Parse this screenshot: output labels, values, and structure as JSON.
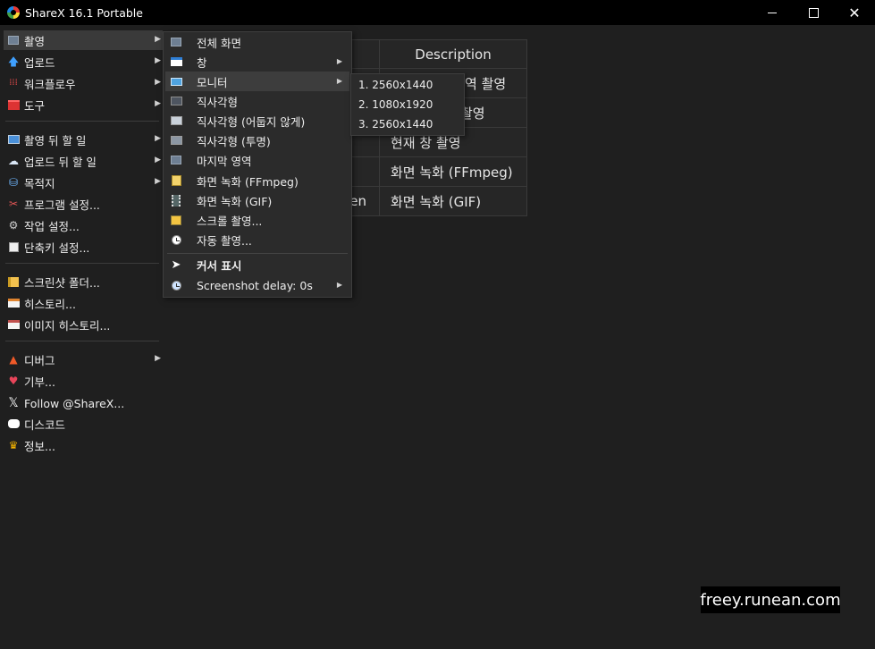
{
  "window": {
    "title": "ShareX 16.1 Portable"
  },
  "main_menu": {
    "items": [
      {
        "label": "촬영",
        "icon": "camera-icon",
        "has_submenu": true,
        "selected": true
      },
      {
        "label": "업로드",
        "icon": "upload-arrow-icon",
        "has_submenu": true
      },
      {
        "label": "워크플로우",
        "icon": "workflow-grid-icon",
        "has_submenu": true
      },
      {
        "label": "도구",
        "icon": "toolbox-icon",
        "has_submenu": true
      },
      {
        "label": "촬영 뒤 할 일",
        "icon": "after-capture-icon",
        "has_submenu": true
      },
      {
        "label": "업로드 뒤 할 일",
        "icon": "after-upload-cloud-icon",
        "has_submenu": true
      },
      {
        "label": "목적지",
        "icon": "destination-icon",
        "has_submenu": true
      },
      {
        "label": "프로그램 설정...",
        "icon": "settings-tools-icon"
      },
      {
        "label": "작업 설정...",
        "icon": "gear-icon"
      },
      {
        "label": "단축키 설정...",
        "icon": "keyboard-icon"
      },
      {
        "label": "스크린샷 폴더...",
        "icon": "folder-icon"
      },
      {
        "label": "히스토리...",
        "icon": "history-icon"
      },
      {
        "label": "이미지 히스토리...",
        "icon": "image-history-icon"
      },
      {
        "label": "디버그",
        "icon": "traffic-cone-icon",
        "has_submenu": true
      },
      {
        "label": "기부...",
        "icon": "heart-icon"
      },
      {
        "label": "Follow @ShareX...",
        "icon": "x-logo-icon"
      },
      {
        "label": "디스코드",
        "icon": "discord-icon"
      },
      {
        "label": "정보...",
        "icon": "crown-icon"
      }
    ]
  },
  "background_table": {
    "header": "Description",
    "rows": [
      "역 촬영",
      "촬영",
      "현재 창 촬영",
      "화면 녹화 (FFmpeg)",
      "화면 녹화 (GIF)"
    ],
    "left_fragment": "en"
  },
  "capture_submenu": {
    "items": [
      {
        "label": "전체 화면",
        "icon": "fullscreen-icon"
      },
      {
        "label": "창",
        "icon": "window-icon",
        "has_submenu": true
      },
      {
        "label": "모니터",
        "icon": "monitor-icon",
        "has_submenu": true,
        "selected": true
      },
      {
        "label": "직사각형",
        "icon": "rectangle-icon"
      },
      {
        "label": "직사각형 (어둡지 않게)",
        "icon": "rectangle-light-icon"
      },
      {
        "label": "직사각형 (투명)",
        "icon": "rectangle-transparent-icon"
      },
      {
        "label": "마지막 영역",
        "icon": "last-region-icon"
      },
      {
        "label": "화면 녹화 (FFmpeg)",
        "icon": "screen-record-ffmpeg-icon"
      },
      {
        "label": "화면 녹화 (GIF)",
        "icon": "screen-record-gif-icon"
      },
      {
        "label": "스크롤 촬영...",
        "icon": "scrolling-capture-icon"
      },
      {
        "label": "자동 촬영...",
        "icon": "auto-capture-clock-icon"
      },
      {
        "label": "커서 표시",
        "icon": "cursor-icon",
        "bold": true
      },
      {
        "label": "Screenshot delay: 0s",
        "icon": "delay-clock-icon",
        "has_submenu": true
      }
    ]
  },
  "monitor_submenu": {
    "items": [
      {
        "label": "1. 2560x1440"
      },
      {
        "label": "2. 1080x1920"
      },
      {
        "label": "3. 2560x1440"
      }
    ]
  },
  "watermark": {
    "text": "freey.runean.com"
  }
}
